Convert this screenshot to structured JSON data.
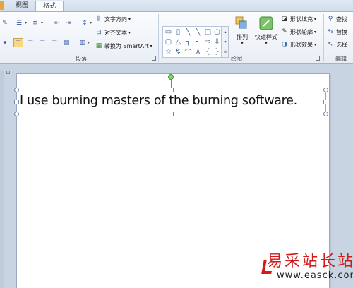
{
  "tabs": [
    {
      "label": "视图"
    },
    {
      "label": "格式"
    }
  ],
  "paragraph": {
    "group_label": "段落",
    "text_direction": "文字方向",
    "align_text": "对齐文本",
    "convert_smartart": "转换为 SmartArt"
  },
  "drawing": {
    "group_label": "绘图",
    "arrange": "排列",
    "quick_styles": "快速样式",
    "shape_fill": "形状填充",
    "shape_outline": "形状轮廓",
    "shape_effects": "形状效果"
  },
  "editing": {
    "group_label": "编辑",
    "find": "查找",
    "replace": "替换",
    "select": "选择"
  },
  "slide": {
    "text": "I use burning masters of the burning software."
  },
  "watermark": {
    "brand": "易采站长站",
    "url": "www.easck.com"
  },
  "colors": {
    "accent_tab": "#e6a53a",
    "watermark": "#d21a1a",
    "rotate_handle": "#88d66b"
  }
}
